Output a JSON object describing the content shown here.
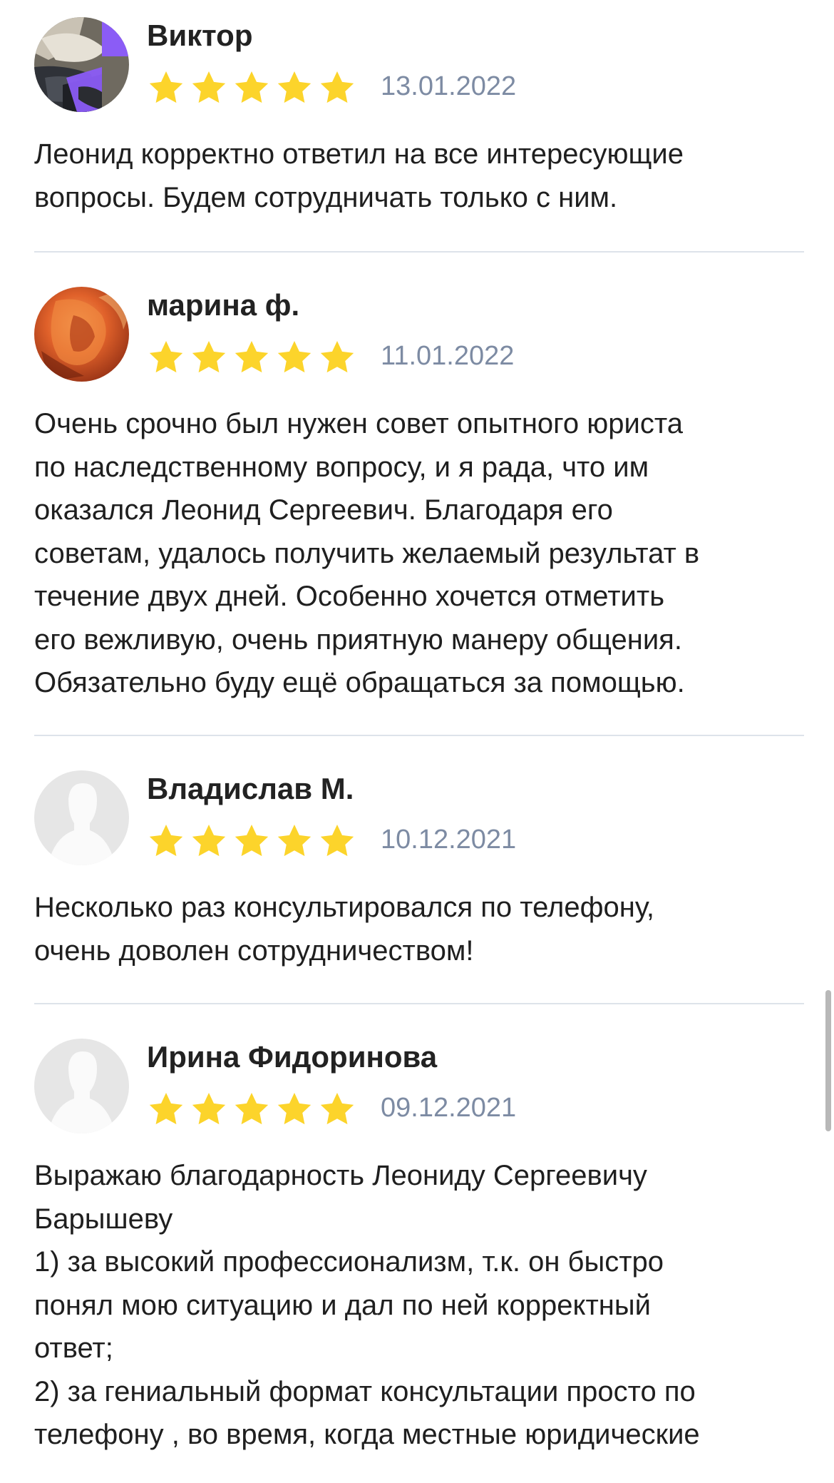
{
  "reviews": [
    {
      "author": "Виктор",
      "avatar": "photo-avatar-bath",
      "rating": 5,
      "date": "13.01.2022",
      "text": "Леонид корректно ответил на все интересующие\nвопросы. Будем сотрудничать только с ним."
    },
    {
      "author": "марина ф.",
      "avatar": "photo-avatar-orange",
      "rating": 5,
      "date": "11.01.2022",
      "text": "Очень срочно был нужен совет опытного юриста\nпо наследственному вопросу, и я рада, что им\nоказался Леонид Сергеевич. Благодаря его\nсоветам, удалось получить желаемый результат в\nтечение двух дней. Особенно хочется отметить\nего вежливую, очень приятную манеру общения.\nОбязательно буду ещё обращаться за помощью."
    },
    {
      "author": "Владислав М.",
      "avatar": "default-user-icon",
      "rating": 5,
      "date": "10.12.2021",
      "text": "Несколько раз консультировался по телефону,\nочень доволен сотрудничеством!"
    },
    {
      "author": "Ирина Фидоринова",
      "avatar": "default-user-icon",
      "rating": 5,
      "date": "09.12.2021",
      "text": "Выражаю благодарность Леониду Сергеевичу\nБарышеву\n1) за высокий профессионализм, т.к. он быстро\nпонял мою ситуацию и дал по ней корректный\nответ;\n2) за гениальный формат консультации просто по\nтелефону , во время, когда местные юридические"
    }
  ],
  "colors": {
    "star": "#fcd42b",
    "date": "#7d8ba3",
    "divider": "#dde3ea",
    "avatar_accent": "#8b5cf6"
  }
}
